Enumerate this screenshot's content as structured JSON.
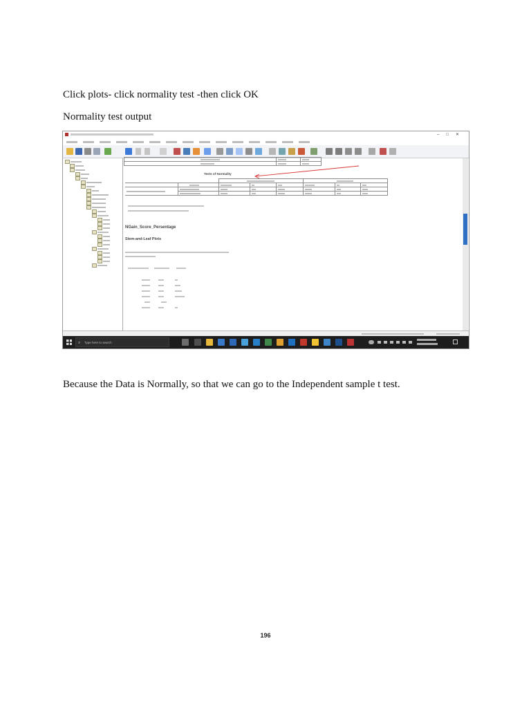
{
  "paragraphs": {
    "p1": "Click plots- click normality test -then click OK",
    "p2": "Normality test output",
    "p3": "Because the Data is Normally, so that we can go to the  Independent sample t test."
  },
  "page_number": "196",
  "screenshot": {
    "output": {
      "normality_table_title": "Tests of Normality",
      "section_heading": "NGain_Score_Persentage",
      "stem_leaf_title": "Stem-and-Leaf Plots"
    },
    "taskbar": {
      "search_placeholder": "Type here to search"
    }
  },
  "colors": {
    "annotation_arrow": "#d63030",
    "taskbar_bg": "#1d1d1d",
    "scroll_thumb": "#2f6fc4"
  }
}
